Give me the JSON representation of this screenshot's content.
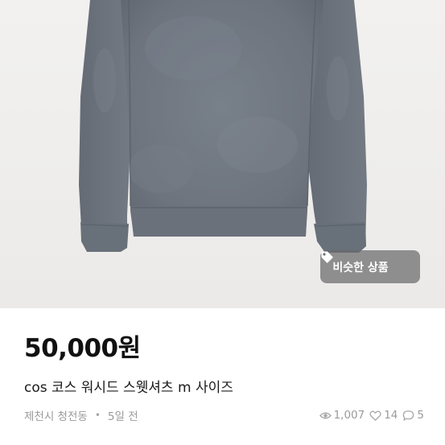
{
  "product": {
    "price": "50,000원",
    "title": "cos 코스 워시드 스웻셔츠 m 사이즈",
    "location": "제천시 청전동",
    "separator": "•",
    "posted": "5일 전",
    "image_description_icon": "sweatshirt-photo"
  },
  "similar_button": {
    "label": "비슷한 상품",
    "icon": "tag-icon"
  },
  "stats": {
    "views": "1,007",
    "likes": "14",
    "chats": "5",
    "views_icon": "eye-icon",
    "likes_icon": "heart-icon",
    "chats_icon": "chat-bubble-icon"
  },
  "colors": {
    "garment": "#6f7680",
    "background": "#efeeec",
    "muted_text": "#9a9a9a"
  }
}
